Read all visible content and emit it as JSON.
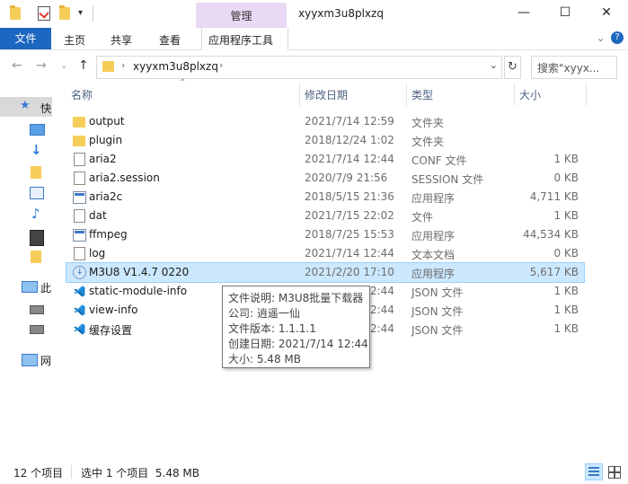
{
  "window": {
    "title": "xyyxm3u8plxzq",
    "manage_label": "管理",
    "minimize": "—",
    "maximize": "☐",
    "close": "✕"
  },
  "ribbon": {
    "tabs": [
      "文件",
      "主页",
      "共享",
      "查看",
      "应用程序工具"
    ]
  },
  "address": {
    "path": "xyyxm3u8plxzq",
    "search_placeholder": "搜索\"xyyx..."
  },
  "nav_pane": {
    "items": [
      "快",
      "",
      "",
      "",
      "",
      "",
      "",
      "",
      "",
      "此",
      "",
      "",
      "网"
    ]
  },
  "columns": [
    "名称",
    "修改日期",
    "类型",
    "大小"
  ],
  "files": [
    {
      "name": "output",
      "date": "2021/7/14 12:59",
      "type": "文件夹",
      "size": "",
      "icon": "folder-icon"
    },
    {
      "name": "plugin",
      "date": "2018/12/24 1:02",
      "type": "文件夹",
      "size": "",
      "icon": "folder-icon"
    },
    {
      "name": "aria2",
      "date": "2021/7/14 12:44",
      "type": "CONF 文件",
      "size": "1 KB",
      "icon": "document-icon"
    },
    {
      "name": "aria2.session",
      "date": "2020/7/9 21:56",
      "type": "SESSION 文件",
      "size": "0 KB",
      "icon": "document-icon"
    },
    {
      "name": "aria2c",
      "date": "2018/5/15 21:36",
      "type": "应用程序",
      "size": "4,711 KB",
      "icon": "application-icon"
    },
    {
      "name": "dat",
      "date": "2021/7/15 22:02",
      "type": "文件",
      "size": "1 KB",
      "icon": "document-icon"
    },
    {
      "name": "ffmpeg",
      "date": "2018/7/25 15:53",
      "type": "应用程序",
      "size": "44,534 KB",
      "icon": "application-icon"
    },
    {
      "name": "log",
      "date": "2021/7/14 12:44",
      "type": "文本文档",
      "size": "0 KB",
      "icon": "document-icon"
    },
    {
      "name": "M3U8 V1.4.7 0220",
      "date": "2021/2/20 17:10",
      "type": "应用程序",
      "size": "5,617 KB",
      "icon": "download-app-icon"
    },
    {
      "name": "static-module-info",
      "date": "2021/7/14 12:44",
      "type": "JSON 文件",
      "size": "1 KB",
      "icon": "vscode-icon"
    },
    {
      "name": "view-info",
      "date": "2021/7/14 12:44",
      "type": "JSON 文件",
      "size": "1 KB",
      "icon": "vscode-icon"
    },
    {
      "name": "缓存设置",
      "date": "2021/7/14 12:44",
      "type": "JSON 文件",
      "size": "1 KB",
      "icon": "vscode-icon"
    }
  ],
  "selected_index": 8,
  "tooltip": {
    "lines": [
      "文件说明: M3U8批量下载器",
      "公司: 逍遥一仙",
      "文件版本: 1.1.1.1",
      "创建日期: 2021/7/14 12:44",
      "大小: 5.48 MB"
    ]
  },
  "status": {
    "item_count": "12 个项目",
    "selection": "选中 1 个项目  5.48 MB"
  },
  "colors": {
    "accent": "#1c67c0",
    "manage_tab": "#e9d9f4",
    "selection": "#cce8ff"
  }
}
